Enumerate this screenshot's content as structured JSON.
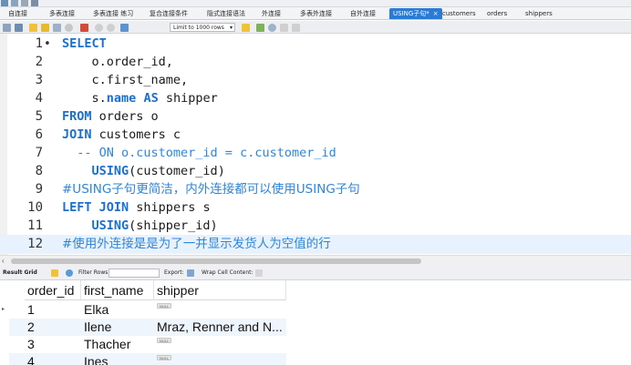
{
  "tabs": [
    {
      "label": "自连接",
      "active": false
    },
    {
      "label": "多表连接",
      "active": false
    },
    {
      "label": "多表连接 练习",
      "active": false
    },
    {
      "label": "复合连接条件",
      "active": false
    },
    {
      "label": "隐式连接语法",
      "active": false
    },
    {
      "label": "外连接",
      "active": false
    },
    {
      "label": "多表外连接",
      "active": false
    },
    {
      "label": "自外连接",
      "active": false
    },
    {
      "label": "USING子句*",
      "active": true,
      "close": "×"
    },
    {
      "label": "customers",
      "active": false
    },
    {
      "label": "orders",
      "active": false
    },
    {
      "label": "shippers",
      "active": false
    }
  ],
  "toolbar": {
    "limit_label": "Limit to 1000 rows",
    "limit_caret": "▾"
  },
  "editor": {
    "lines": [
      {
        "num": "1",
        "dot": "•",
        "parts": [
          {
            "t": "SELECT",
            "c": "kw"
          }
        ]
      },
      {
        "num": "2",
        "parts": [
          {
            "t": "    o.order_id,",
            "c": ""
          }
        ]
      },
      {
        "num": "3",
        "parts": [
          {
            "t": "    c.first_name,",
            "c": ""
          }
        ]
      },
      {
        "num": "4",
        "parts": [
          {
            "t": "    s.",
            "c": ""
          },
          {
            "t": "name",
            "c": "kw"
          },
          {
            "t": " ",
            "c": ""
          },
          {
            "t": "AS",
            "c": "kw"
          },
          {
            "t": " shipper",
            "c": ""
          }
        ]
      },
      {
        "num": "5",
        "parts": [
          {
            "t": "FROM",
            "c": "kw"
          },
          {
            "t": " orders o",
            "c": ""
          }
        ]
      },
      {
        "num": "6",
        "parts": [
          {
            "t": "JOIN",
            "c": "kw"
          },
          {
            "t": " customers c",
            "c": ""
          }
        ]
      },
      {
        "num": "7",
        "parts": [
          {
            "t": "  -- ON o.customer_id = c.customer_id",
            "c": "cm"
          }
        ]
      },
      {
        "num": "8",
        "parts": [
          {
            "t": "    ",
            "c": ""
          },
          {
            "t": "USING",
            "c": "kw"
          },
          {
            "t": "(customer_id)",
            "c": ""
          }
        ]
      },
      {
        "num": "9",
        "parts": [
          {
            "t": "#USING子句更简洁，内外连接都可以使用USING子句",
            "c": "cmz"
          }
        ]
      },
      {
        "num": "10",
        "parts": [
          {
            "t": "LEFT",
            "c": "kw"
          },
          {
            "t": " ",
            "c": ""
          },
          {
            "t": "JOIN",
            "c": "kw"
          },
          {
            "t": " shippers s",
            "c": ""
          }
        ]
      },
      {
        "num": "11",
        "parts": [
          {
            "t": "    ",
            "c": ""
          },
          {
            "t": "USING",
            "c": "kw"
          },
          {
            "t": "(shipper_id)",
            "c": ""
          }
        ]
      },
      {
        "num": "12",
        "current": true,
        "parts": [
          {
            "t": "#使用外连接是是为了一并显示发货人为空值的行",
            "c": "cmz"
          }
        ]
      }
    ]
  },
  "scrollbar": {
    "left_arrow": "‹"
  },
  "result_toolbar": {
    "result_grid_label": "Result Grid",
    "filter_rows_label": "Filter Rows:",
    "export_label": "Export:",
    "wrap_label": "Wrap Cell Content:"
  },
  "grid": {
    "columns": [
      "order_id",
      "first_name",
      "shipper"
    ],
    "null_badge": "NULL",
    "row_marker": "▸",
    "rows": [
      {
        "order_id": "1",
        "first_name": "Elka",
        "shipper": null
      },
      {
        "order_id": "2",
        "first_name": "Ilene",
        "shipper": "Mraz, Renner and N..."
      },
      {
        "order_id": "3",
        "first_name": "Thacher",
        "shipper": null
      },
      {
        "order_id": "4",
        "first_name": "Ines",
        "shipper": null
      }
    ]
  },
  "colors": {
    "keyword": "#1a6fd0",
    "comment": "#2e86d8",
    "active_tab": "#2a7bd6",
    "current_line": "#e8f2fe",
    "even_row": "#eef5fd"
  }
}
